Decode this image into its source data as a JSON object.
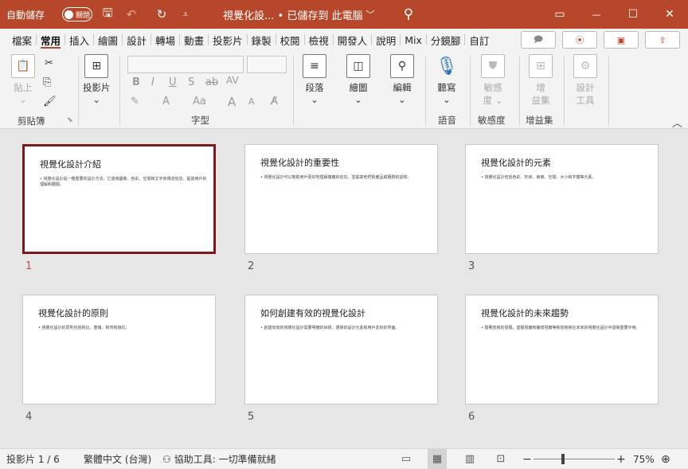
{
  "titlebar": {
    "autosave_label": "自動儲存",
    "autosave_state": "關閉",
    "document_title": "視覺化設... • 已儲存到 此電腦",
    "title_chevron": "﹀",
    "save_glyph": "🖫",
    "undo_glyph": "↶",
    "redo_glyph": "↻",
    "qat_more_glyph": "⩡",
    "search_glyph": "⚲",
    "ribbon_display_glyph": "▭",
    "minimize_glyph": "—",
    "maximize_glyph": "☐",
    "close_glyph": "✕"
  },
  "ribbon_tabs": [
    "檔案",
    "常用",
    "插入",
    "繪圖",
    "設計",
    "轉場",
    "動畫",
    "投影片",
    "錄製",
    "校閱",
    "檢視",
    "開發人",
    "說明",
    "Mix",
    "分鏡腳",
    "自訂"
  ],
  "active_tab": "常用",
  "ribbon_right": {
    "comments_glyph": "🗩",
    "record_glyph": "⦿",
    "present_glyph": "▣",
    "share_glyph": "⇪"
  },
  "ribbon": {
    "clipboard": {
      "label": "剪貼簿",
      "paste_label": "貼上",
      "paste_sub": "⌄",
      "cut_glyph": "✂",
      "copy_glyph": "⎘",
      "format_painter_glyph": "🖌",
      "launcher_glyph": "⬊"
    },
    "slides": {
      "new_slide_label": "投影片",
      "new_slide_sub": "⌄",
      "glyph": "⊞"
    },
    "font": {
      "label": "字型",
      "bold": "B",
      "italic": "I",
      "underline": "U",
      "shadow": "S",
      "strike": "ab",
      "spacing": "AV",
      "highlight": "✎",
      "font_color": "A",
      "case": "Aa",
      "grow": "A",
      "shrink": "A",
      "clear": "A̸"
    },
    "paragraph": {
      "label": "段落",
      "sub": "⌄",
      "glyph": "≡"
    },
    "drawing": {
      "label": "繪圖",
      "sub": "⌄",
      "glyph": "◫"
    },
    "editing": {
      "label": "編輯",
      "sub": "⌄",
      "glyph": "⚲"
    },
    "voice": {
      "label": "語音",
      "dictate_label": "聽寫",
      "sub": "⌄",
      "glyph": "🎙"
    },
    "sensitivity": {
      "label": "敏感度",
      "btn_line1": "敏感",
      "btn_line2": "度 ⌄",
      "glyph": "⛊"
    },
    "addins": {
      "label": "增益集",
      "btn_line1": "增",
      "btn_line2": "益集",
      "glyph": "⊞"
    },
    "designer": {
      "btn_line1": "設計",
      "btn_line2": "工具",
      "glyph": "⚙"
    },
    "collapse_glyph": "︿"
  },
  "slides": [
    {
      "number": "1",
      "title": "視覺化設計介紹",
      "body": "• 視覺化設計是一種重要的設計方法，它運用圖像、色彩、空間和文字來傳達信息，提高用戶的理解和體驗。"
    },
    {
      "number": "2",
      "title": "視覺化設計的重要性",
      "body": "• 視覺化設計可以幫助用戶更好地理解複雜的信息，並提高他們對產品或服務的認知。"
    },
    {
      "number": "3",
      "title": "視覺化設計的元素",
      "body": "• 視覺化設計包括色彩、形狀、線條、空間、大小和字體等元素。"
    },
    {
      "number": "4",
      "title": "視覺化設計的原則",
      "body": "• 視覺化設計的原則包括對比、重複、對齊和接近。"
    },
    {
      "number": "5",
      "title": "如何創建有效的視覺化設計",
      "body": "• 創建有效的視覺化設計需要明確的目標，選擇的設計元素和用戶友好的界面。"
    },
    {
      "number": "6",
      "title": "視覺化設計的未來趨勢",
      "body": "• 隨著技術的發展，虛擬現實和擴增現實等新技術將在未來的視覺化設計中發揮重要作用。"
    }
  ],
  "statusbar": {
    "slide_indicator": "投影片 1 / 6",
    "language": "繁體中文 (台灣)",
    "accessibility_glyph": "⚇",
    "accessibility": "協助工具: 一切準備就緒",
    "notes_glyph": "▭",
    "sorter_glyph": "▦",
    "reading_glyph": "▥",
    "slideshow_glyph": "⊡",
    "zoom_out": "−",
    "zoom_in": "+",
    "zoom_level": "75%",
    "zoom_percent": 75,
    "fit_glyph": "⊕"
  }
}
